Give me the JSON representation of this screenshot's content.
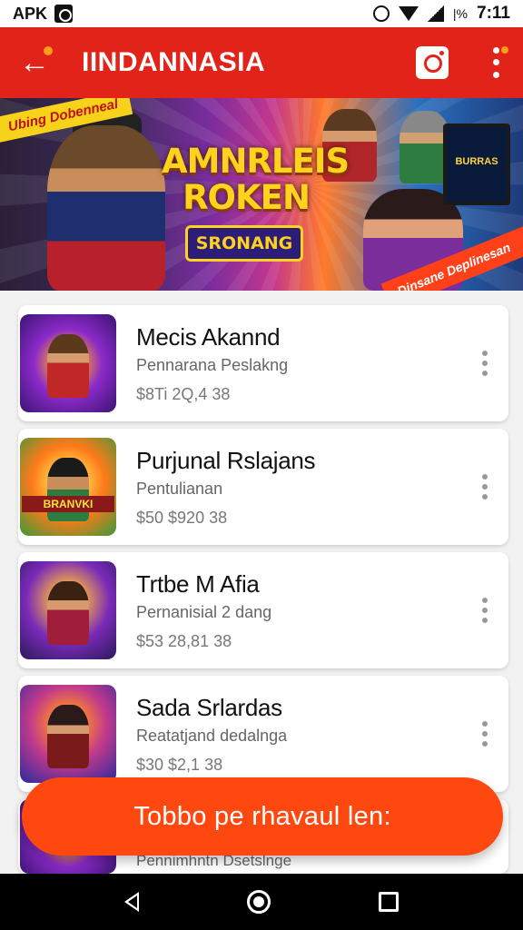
{
  "status_bar": {
    "left_text": "APK",
    "battery": "|%",
    "time": "7:11"
  },
  "app_bar": {
    "title": "IINDANNASIA"
  },
  "banner": {
    "title": "AMNRLEIS ROKEN",
    "ribbon": "SRONANG",
    "tag_left": "Ubing Dobenneal",
    "tag_right": "Dinsane Deplinesan",
    "screen_text": "BURRAS"
  },
  "items": [
    {
      "title": "Mecis Akannd",
      "subtitle": "Pennarana  Peslakng",
      "price": "$8Ti 2Q,4 38",
      "thumb_label": ""
    },
    {
      "title": "Purjunal Rslajans",
      "subtitle": "Pentulianan",
      "price": "$50 $920 38",
      "thumb_label": "BRANVKI"
    },
    {
      "title": "Trtbe M Afia",
      "subtitle": "Pernanisial 2 dang",
      "price": "$53 28,81 38",
      "thumb_label": ""
    },
    {
      "title": "Sada Srlardas",
      "subtitle": "Reatatjand dedalnga",
      "price": "$30 $2,1 38",
      "thumb_label": ""
    }
  ],
  "partial_item": {
    "subtitle": "Pennimhntn Dsetslnge"
  },
  "cta": {
    "label": "Tobbo pe rhavaul len:"
  },
  "colors": {
    "primary": "#e2231a",
    "cta": "#ff4810",
    "accent": "#ff9c1a"
  },
  "icons": [
    "back-arrow-icon",
    "camera-icon",
    "more-vertical-icon",
    "nav-back-icon",
    "nav-home-icon",
    "nav-recents-icon"
  ]
}
